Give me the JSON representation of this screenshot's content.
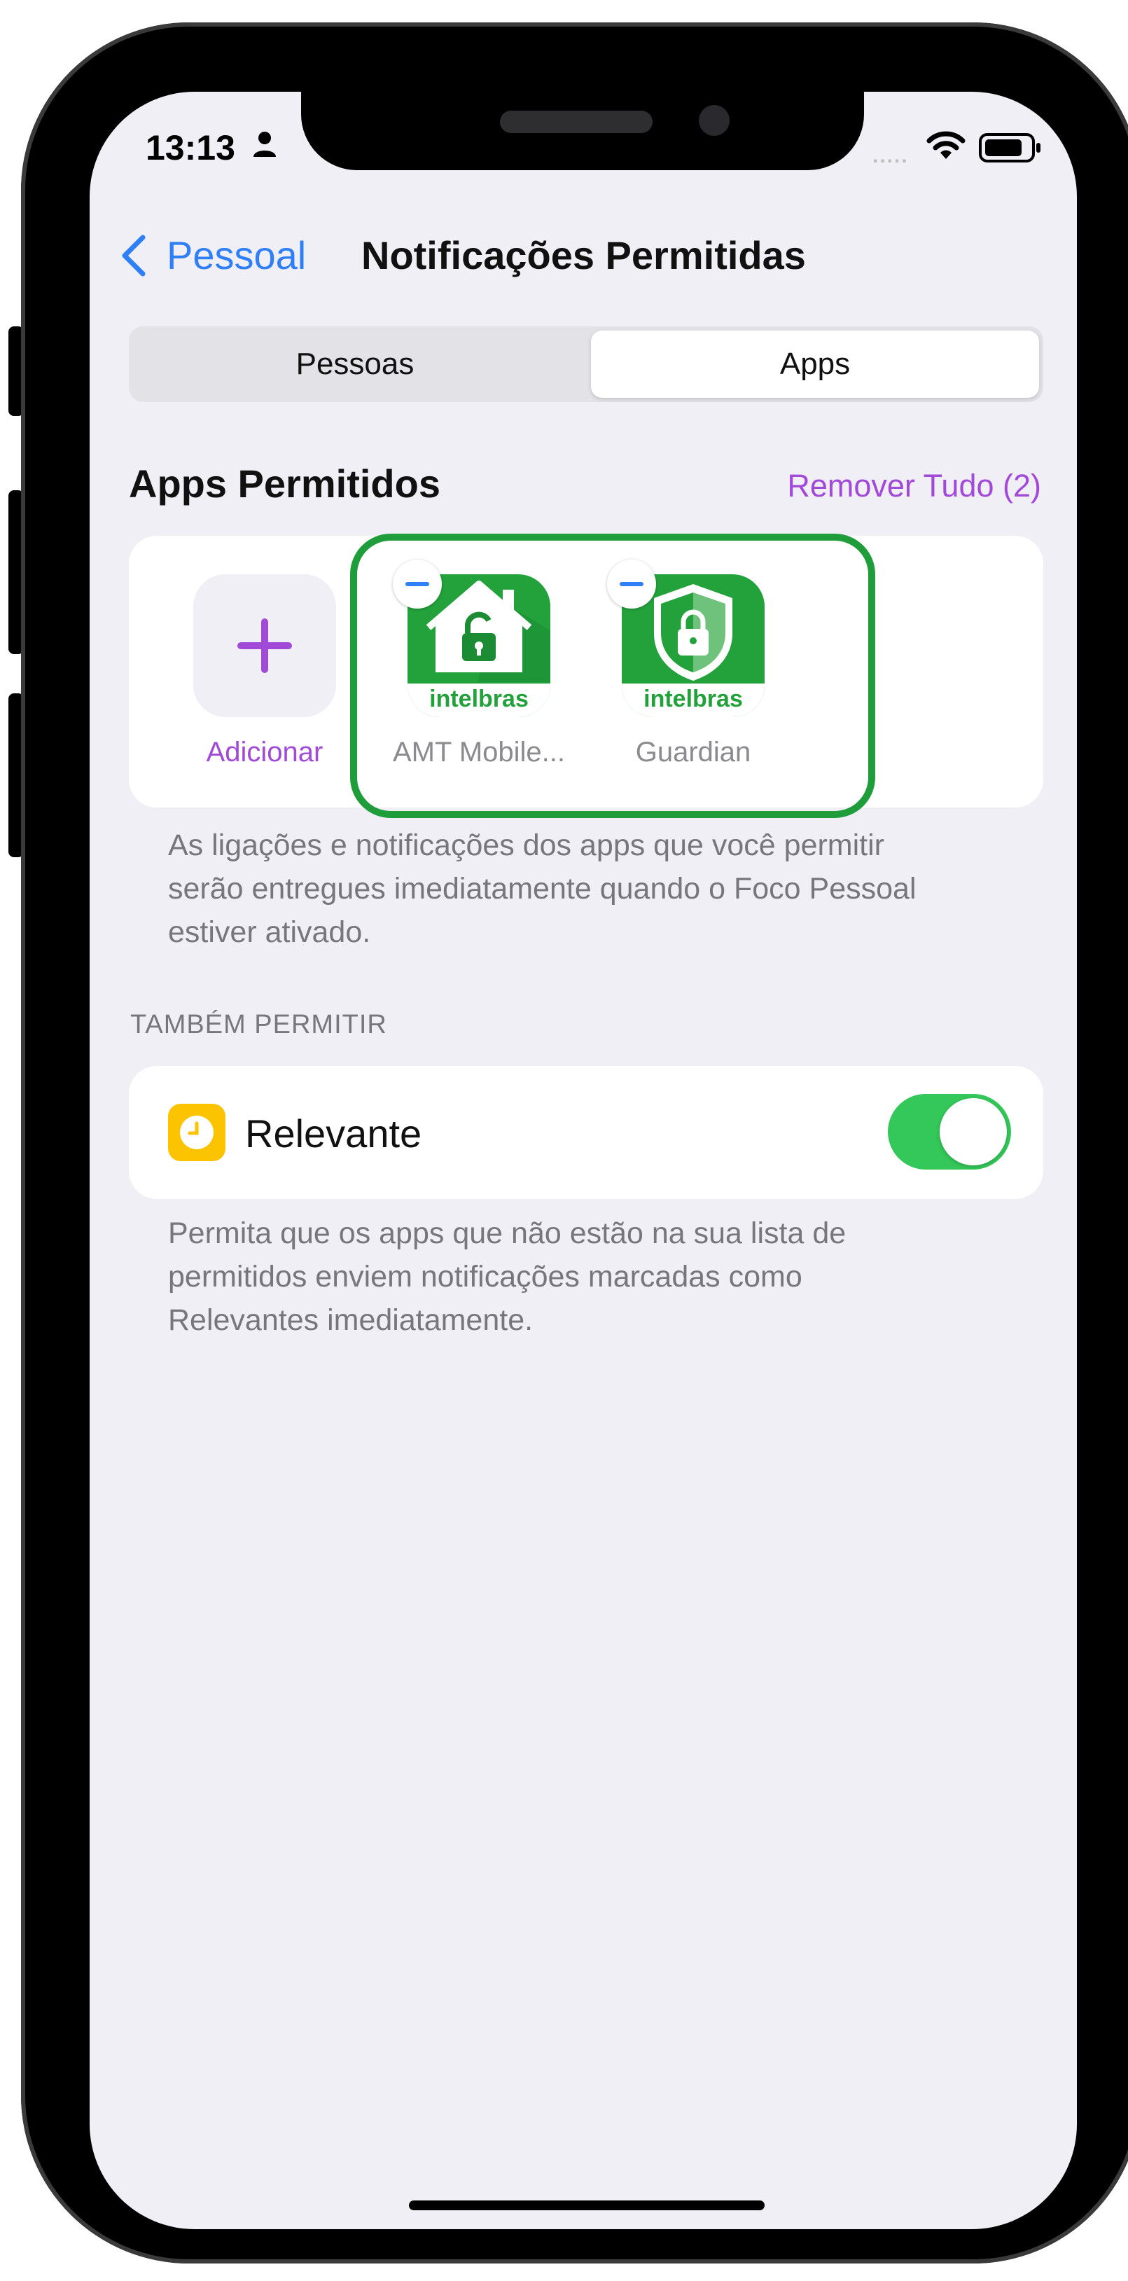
{
  "status_bar": {
    "time": "13:13",
    "signal": "....."
  },
  "nav": {
    "back_label": "Pessoal",
    "title": "Notificações Permitidas"
  },
  "segmented": {
    "left": "Pessoas",
    "right": "Apps",
    "selected": "Apps"
  },
  "apps_section": {
    "title": "Apps Permitidos",
    "remove_all": "Remover Tudo (2)",
    "add_label": "Adicionar",
    "apps": [
      {
        "label": "AMT Mobile...",
        "brand": "intelbras",
        "icon": "house-lock-icon"
      },
      {
        "label": "Guardian",
        "brand": "intelbras",
        "icon": "shield-lock-icon"
      }
    ],
    "footnote_lines": [
      "As ligações e notificações dos apps que você permitir",
      "serão entregues imediatamente quando o Foco Pessoal",
      "estiver ativado."
    ]
  },
  "also_allow": {
    "header": "TAMBÉM PERMITIR",
    "relevant_label": "Relevante",
    "relevant_enabled": true,
    "footnote_lines": [
      "Permita que os apps que não estão na sua lista de",
      "permitidos enviem notificações marcadas como",
      "Relevantes imediatamente."
    ]
  },
  "colors": {
    "accent": "#a24ad8",
    "link": "#2f7ff6",
    "toggle_on": "#34c759",
    "highlight": "#1f9d3b",
    "app_green": "#23a23c"
  }
}
